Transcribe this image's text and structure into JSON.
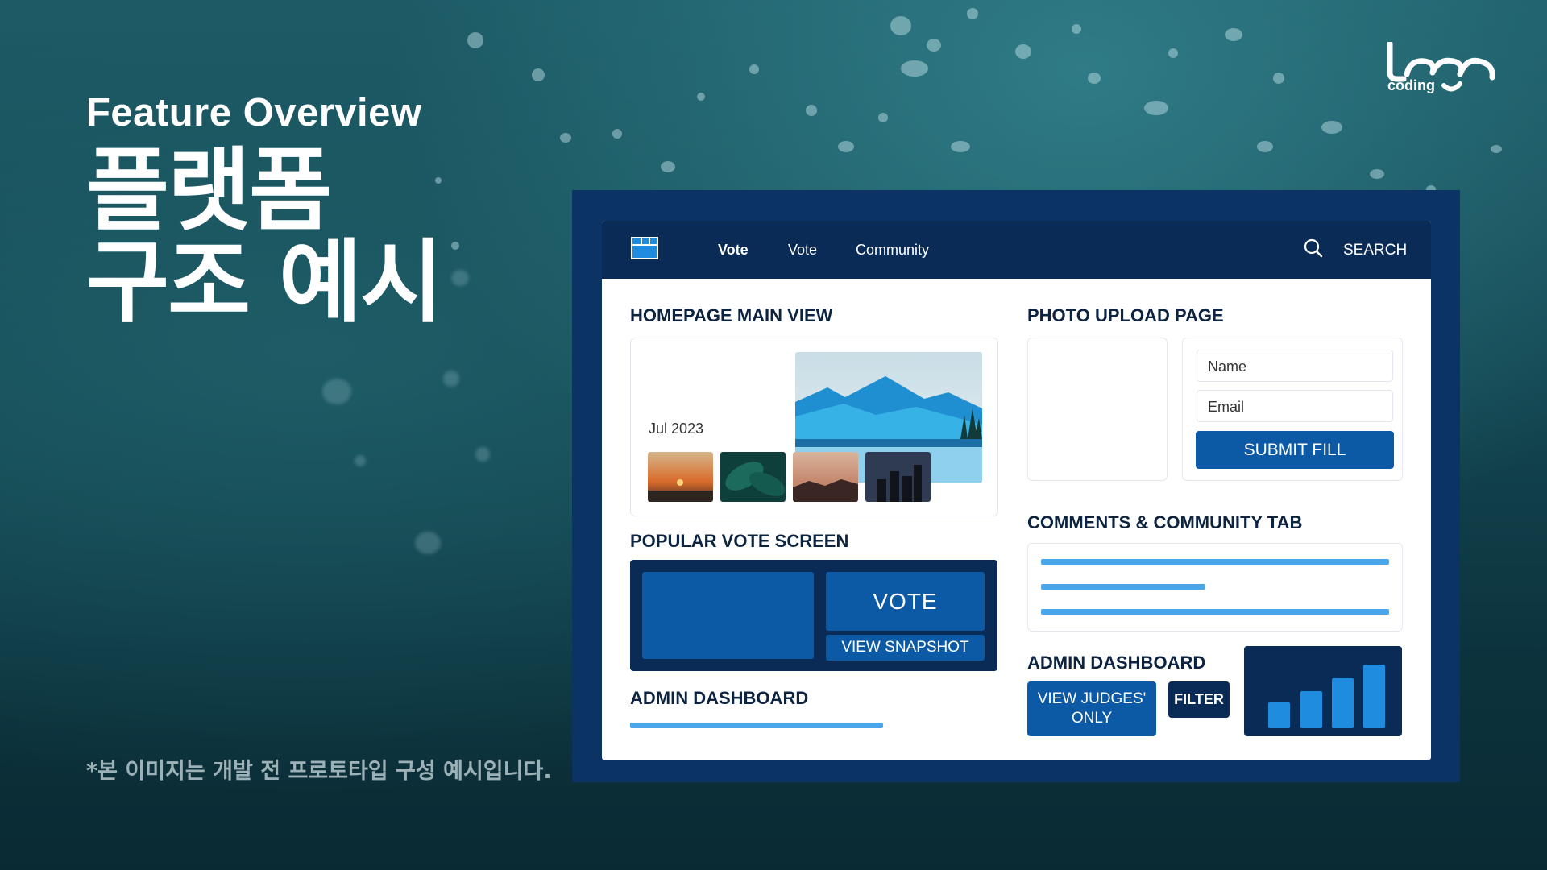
{
  "slide": {
    "kicker": "Feature Overview",
    "headline_line1": "플랫폼",
    "headline_line2": "구조 예시",
    "footnote": "*본 이미지는 개발 전 프로토타입 구성 예시입니다.",
    "logo_text": "coding"
  },
  "nav": {
    "links": [
      "Vote",
      "Vote",
      "Community"
    ],
    "search_label": "SEARCH"
  },
  "homepage": {
    "title": "HOMEPAGE MAIN VIEW",
    "date": "Jul 2023",
    "thumbnails": [
      "sunset-thumb",
      "leaves-thumb",
      "dusk-hills-thumb",
      "city-skyline-thumb"
    ]
  },
  "vote": {
    "title": "POPULAR VOTE SCREEN",
    "vote_label": "VOTE",
    "snapshot_label": "VIEW SNAPSHOT"
  },
  "admin_left": {
    "title": "ADMIN DASHBOARD",
    "progress": 0.69
  },
  "upload": {
    "title": "PHOTO UPLOAD PAGE",
    "name_placeholder": "Name",
    "email_placeholder": "Email",
    "submit_label": "SUBMIT FILL"
  },
  "comments": {
    "title": "COMMENTS & COMMUNITY TAB",
    "lines": [
      1.0,
      0.47,
      1.0
    ]
  },
  "admin_right": {
    "title": "ADMIN DASHBOARD",
    "judges_label": "VIEW JUDGES' ONLY",
    "filter_label": "FILTER",
    "bar_values": [
      0.33,
      0.48,
      0.65,
      0.82
    ]
  },
  "colors": {
    "navy": "#0a2b55",
    "blue": "#0c5aa6",
    "accent": "#4aa6ea"
  }
}
